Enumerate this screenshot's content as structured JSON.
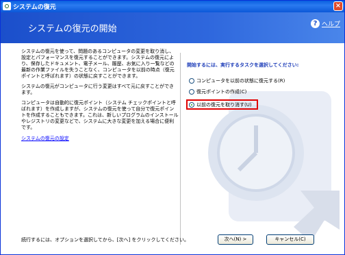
{
  "window": {
    "title": "システムの復元"
  },
  "header": {
    "title": "システムの復元の開始",
    "help_label": "ヘルプ"
  },
  "left": {
    "paragraphs": [
      "システムの復元を使って、問題のあるコンピュータの変更を取り消し、設定とパフォーマンスを復元することができます。システムの復元により、保存したドキュメント、電子メール、履歴、お気に入り一覧などの最新の作業ファイルを失うことなく、コンピュータを以前の時点（復元ポイントと呼ばれます）の状態に戻すことができます。",
      "システムの復元がコンピュータに行う変更はすべて元に戻すことができます。",
      "コンピュータは自動的に復元ポイント（システム チェックポイントと呼ばれます）を作成しますが、システムの復元を使って自分で復元ポイントを作成することもできます。これは、新しいプログラムのインストールやレジストリの変更などで、システムに大きな変更を加える場合に便利です。"
    ],
    "settings_link": "システムの復元の設定"
  },
  "right": {
    "prompt": "開始するには、実行するタスクを選択してください:",
    "options": [
      {
        "label": "コンピュータを以前の状態に復元する(R)",
        "selected": false
      },
      {
        "label": "復元ポイントの作成(C)",
        "selected": false
      },
      {
        "label": "以前の復元を取り消す(U)",
        "selected": true
      }
    ]
  },
  "footer": {
    "instruction": "続行するには、オプションを選択してから、[次へ] をクリックしてください。",
    "next_label": "次へ(N) >",
    "cancel_label": "キャンセル(C)"
  },
  "colors": {
    "title_blue": "#0a5fe0",
    "header_blue": "#1b4fcb",
    "highlight_red": "#e00000"
  }
}
